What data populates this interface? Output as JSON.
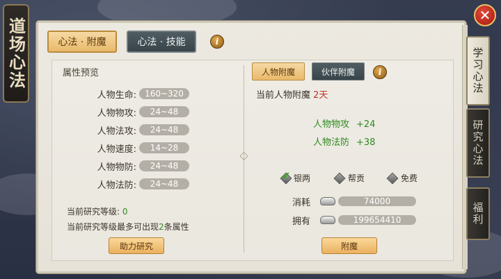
{
  "banner": {
    "title": "道场心法"
  },
  "close_label": "✕",
  "top_tabs": [
    {
      "label": "心法 · 附魔",
      "active": true
    },
    {
      "label": "心法 · 技能",
      "active": false
    }
  ],
  "info_icon_glyph": "i",
  "left": {
    "section_title": "属性预览",
    "attributes": [
      {
        "label": "人物生命:",
        "value": "160~320"
      },
      {
        "label": "人物物攻:",
        "value": "24~48"
      },
      {
        "label": "人物法攻:",
        "value": "24~48"
      },
      {
        "label": "人物速度:",
        "value": "14~28"
      },
      {
        "label": "人物物防:",
        "value": "24~48"
      },
      {
        "label": "人物法防:",
        "value": "24~48"
      }
    ],
    "research_level_label": "当前研究等级:",
    "research_level_value": "0",
    "max_attr_prefix": "当前研究等级最多可出现",
    "max_attr_count": "2",
    "max_attr_suffix": "条属性",
    "assist_button": "助力研究"
  },
  "right": {
    "sub_tabs": [
      {
        "label": "人物附魔",
        "active": true
      },
      {
        "label": "伙伴附魔",
        "active": false
      }
    ],
    "current_label": "当前人物附魔",
    "current_value": "2天",
    "bonuses": [
      {
        "name": "人物物攻",
        "value": "+24"
      },
      {
        "name": "人物法防",
        "value": "+38"
      }
    ],
    "payment_options": [
      {
        "label": "银两",
        "selected": true
      },
      {
        "label": "帮贡",
        "selected": false
      },
      {
        "label": "免费",
        "selected": false
      }
    ],
    "cost_label": "消耗",
    "cost_value": "74000",
    "own_label": "拥有",
    "own_value": "199654410",
    "enchant_button": "附魔"
  },
  "side_tabs": [
    {
      "label": "学习心法",
      "active": true
    },
    {
      "label": "研究心法",
      "active": false
    },
    {
      "label": "福利",
      "active": false
    }
  ]
}
